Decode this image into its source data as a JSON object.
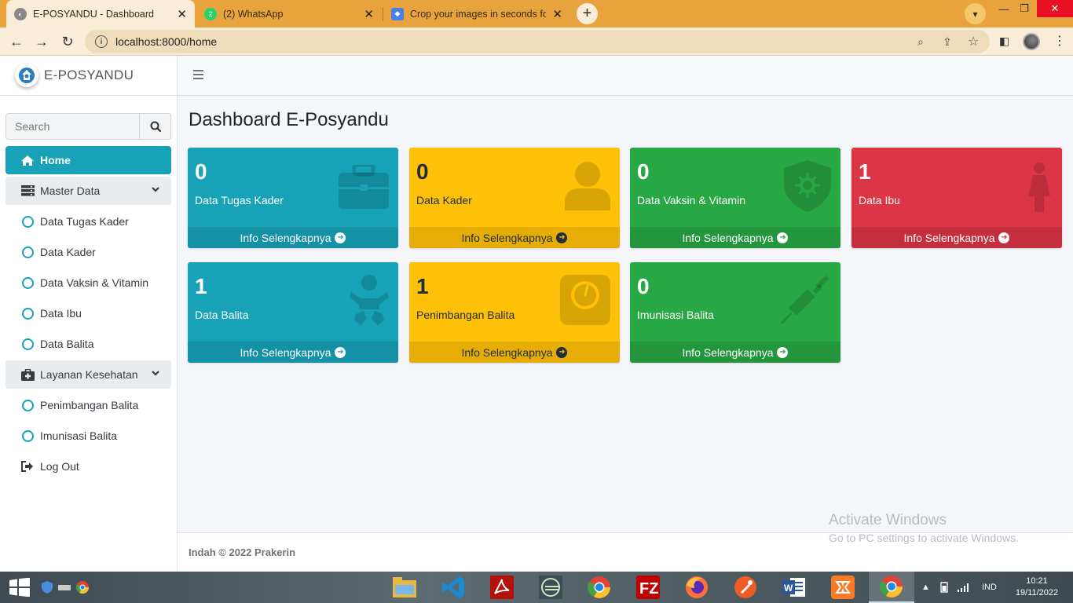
{
  "browser": {
    "tabs": [
      {
        "title": "E-POSYANDU - Dashboard",
        "active": true
      },
      {
        "title": "(2) WhatsApp",
        "active": false
      },
      {
        "title": "Crop your images in seconds for",
        "active": false
      }
    ],
    "url": "localhost:8000/home",
    "icons": [
      "back-icon",
      "forward-icon",
      "reload-icon",
      "info-icon",
      "zoom-icon",
      "share-icon",
      "star-icon",
      "sidepanel-icon",
      "menu-icon"
    ]
  },
  "app": {
    "brand": "E-POSYANDU",
    "search_placeholder": "Search",
    "page_title": "Dashboard E-Posyandu",
    "menu": {
      "home": "Home",
      "master_data": "Master Data",
      "master_items": [
        "Data Tugas Kader",
        "Data Kader",
        "Data Vaksin & Vitamin",
        "Data Ibu",
        "Data Balita"
      ],
      "layanan": "Layanan Kesehatan",
      "layanan_items": [
        "Penimbangan Balita",
        "Imunisasi Balita"
      ],
      "logout": "Log Out"
    },
    "cards": [
      {
        "value": "0",
        "label": "Data Tugas Kader",
        "link": "Info Selengkapnya",
        "color": "#17a2b8",
        "icon": "briefcase-icon"
      },
      {
        "value": "0",
        "label": "Data Kader",
        "link": "Info Selengkapnya",
        "color": "#ffc107",
        "icon": "user-icon"
      },
      {
        "value": "0",
        "label": "Data Vaksin & Vitamin",
        "link": "Info Selengkapnya",
        "color": "#28a745",
        "icon": "virus-shield-icon"
      },
      {
        "value": "1",
        "label": "Data Ibu",
        "link": "Info Selengkapnya",
        "color": "#dc3545",
        "icon": "female-icon"
      },
      {
        "value": "1",
        "label": "Data Balita",
        "link": "Info Selengkapnya",
        "color": "#17a2b8",
        "icon": "baby-icon"
      },
      {
        "value": "1",
        "label": "Penimbangan Balita",
        "link": "Info Selengkapnya",
        "color": "#ffc107",
        "icon": "weight-scale-icon"
      },
      {
        "value": "0",
        "label": "Imunisasi Balita",
        "link": "Info Selengkapnya",
        "color": "#28a745",
        "icon": "syringe-icon"
      }
    ],
    "footer": "Indah © 2022 Prakerin"
  },
  "watermark": {
    "line1": "Activate Windows",
    "line2": "Go to PC settings to activate Windows."
  },
  "taskbar": {
    "lang": "IND",
    "time": "10:21",
    "date": "19/11/2022"
  }
}
